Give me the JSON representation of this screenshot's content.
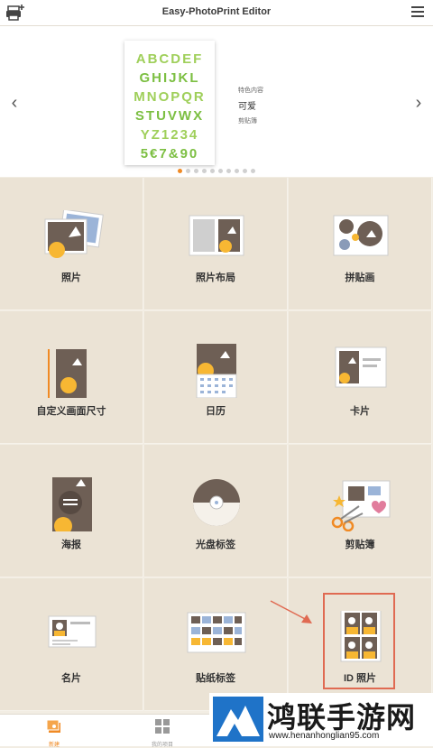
{
  "app": {
    "title": "Easy-PhotoPrint Editor"
  },
  "banner": {
    "font_rows": [
      "ABCDEF",
      "GHIJKL",
      "MNOPQR",
      "STUVWX",
      "YZ1234",
      "5€7&90"
    ],
    "category": "特色内容",
    "name": "可爱",
    "subtitle": "剪贴簿",
    "prev_icon": "chevron-left-icon",
    "next_icon": "chevron-right-icon",
    "page_count": 10,
    "active_page": 1
  },
  "tiles": [
    {
      "label": "照片",
      "icon": "photo-icon"
    },
    {
      "label": "照片布局",
      "icon": "photo-layout-icon"
    },
    {
      "label": "拼贴画",
      "icon": "collage-icon"
    },
    {
      "label": "自定义画面尺寸",
      "icon": "custom-size-icon"
    },
    {
      "label": "日历",
      "icon": "calendar-icon"
    },
    {
      "label": "卡片",
      "icon": "card-icon"
    },
    {
      "label": "海报",
      "icon": "poster-icon"
    },
    {
      "label": "光盘标签",
      "icon": "disc-label-icon"
    },
    {
      "label": "剪贴簿",
      "icon": "scrapbook-icon"
    },
    {
      "label": "名片",
      "icon": "business-card-icon"
    },
    {
      "label": "贴纸标签",
      "icon": "sticker-icon"
    },
    {
      "label": "ID 照片",
      "icon": "id-photo-icon"
    }
  ],
  "bottom_nav": [
    {
      "label": "新建",
      "icon": "new-icon",
      "active": true
    },
    {
      "label": "我的项目",
      "icon": "grid-icon",
      "active": false
    }
  ],
  "watermark": {
    "title": "鸿联手游网",
    "url": "www.henanhonglian95.com"
  },
  "colors": {
    "accent": "#f08a24",
    "tile_bg": "#ebe3d5",
    "highlight": "#e06a52",
    "font_green": "#7cbf42"
  }
}
